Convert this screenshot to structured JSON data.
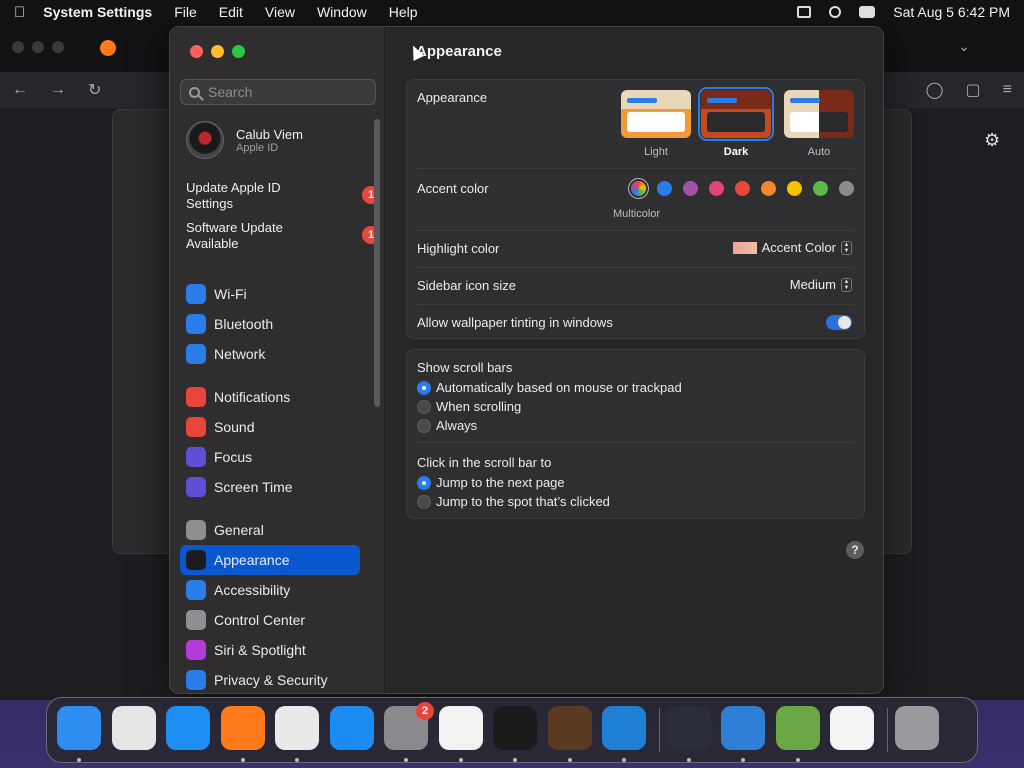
{
  "menubar": {
    "app_name": "System Settings",
    "menus": [
      "File",
      "Edit",
      "View",
      "Window",
      "Help"
    ],
    "datetime": "Sat Aug 5  6:42 PM"
  },
  "window": {
    "title": "Appearance"
  },
  "sidebar": {
    "search_placeholder": "Search",
    "user": {
      "name": "Calub Viem",
      "subtitle": "Apple ID"
    },
    "notices": [
      {
        "label": "Update Apple ID Settings",
        "badge": "1"
      },
      {
        "label": "Software Update Available",
        "badge": "1"
      }
    ],
    "items": [
      {
        "label": "Wi-Fi",
        "icon": "wifi-icon",
        "color": "#2a7ce8"
      },
      {
        "label": "Bluetooth",
        "icon": "bluetooth-icon",
        "color": "#2a7ce8"
      },
      {
        "label": "Network",
        "icon": "globe-icon",
        "color": "#2a7ce8"
      },
      {
        "label": "Notifications",
        "icon": "bell-icon",
        "color": "#e8453c"
      },
      {
        "label": "Sound",
        "icon": "speaker-icon",
        "color": "#e8453c"
      },
      {
        "label": "Focus",
        "icon": "moon-icon",
        "color": "#5e4fd6"
      },
      {
        "label": "Screen Time",
        "icon": "hourglass-icon",
        "color": "#5e4fd6"
      },
      {
        "label": "General",
        "icon": "gear-icon",
        "color": "#8e8e93"
      },
      {
        "label": "Appearance",
        "icon": "appearance-icon",
        "color": "#1c1c1e"
      },
      {
        "label": "Accessibility",
        "icon": "accessibility-icon",
        "color": "#2a7ce8"
      },
      {
        "label": "Control Center",
        "icon": "control-center-icon",
        "color": "#8e8e93"
      },
      {
        "label": "Siri & Spotlight",
        "icon": "siri-icon",
        "color": "#b43bd6"
      },
      {
        "label": "Privacy & Security",
        "icon": "hand-icon",
        "color": "#2a7ce8"
      }
    ],
    "selected": "Appearance"
  },
  "appearance": {
    "label": "Appearance",
    "options": [
      {
        "label": "Light"
      },
      {
        "label": "Dark",
        "selected": true
      },
      {
        "label": "Auto"
      }
    ],
    "accent_label": "Accent color",
    "accent_colors": [
      "multicolor",
      "#2a7ce8",
      "#a550a7",
      "#e0457c",
      "#e8453c",
      "#f3862b",
      "#f5c100",
      "#5bb84a",
      "#8c8c8c"
    ],
    "accent_selected_label": "Multicolor",
    "highlight_label": "Highlight color",
    "highlight_value": "Accent Color",
    "sidebar_icon_label": "Sidebar icon size",
    "sidebar_icon_value": "Medium",
    "tinting_label": "Allow wallpaper tinting in windows",
    "tinting_on": true
  },
  "scroll": {
    "show_label": "Show scroll bars",
    "show_options": [
      "Automatically based on mouse or trackpad",
      "When scrolling",
      "Always"
    ],
    "click_label": "Click in the scroll bar to",
    "click_options": [
      "Jump to the next page",
      "Jump to the spot that’s clicked"
    ]
  },
  "dock": {
    "apps": [
      {
        "name": "finder",
        "color": "#2f8cf0"
      },
      {
        "name": "launchpad",
        "color": "#e5e5e5"
      },
      {
        "name": "safari",
        "color": "#1e8ef3"
      },
      {
        "name": "firefox",
        "color": "#ff7a1a"
      },
      {
        "name": "chrome",
        "color": "#e9e9e9"
      },
      {
        "name": "app-store",
        "color": "#1c8cf2"
      },
      {
        "name": "system-settings",
        "color": "#8a8a8e",
        "badge": "2"
      },
      {
        "name": "textedit",
        "color": "#f2f2f2"
      },
      {
        "name": "terminal",
        "color": "#1b1b1b"
      },
      {
        "name": "garageband",
        "color": "#5a3a20"
      },
      {
        "name": "vscode",
        "color": "#1f7fd4"
      },
      {
        "name": "davinci-resolve",
        "color": "#2a2e3a"
      },
      {
        "name": "icloud-weather",
        "color": "#2e7fd6"
      },
      {
        "name": "minecraft",
        "color": "#6aa845"
      },
      {
        "name": "java",
        "color": "#f5f5f5"
      },
      {
        "name": "trash",
        "color": "#9a9a9e"
      }
    ]
  }
}
